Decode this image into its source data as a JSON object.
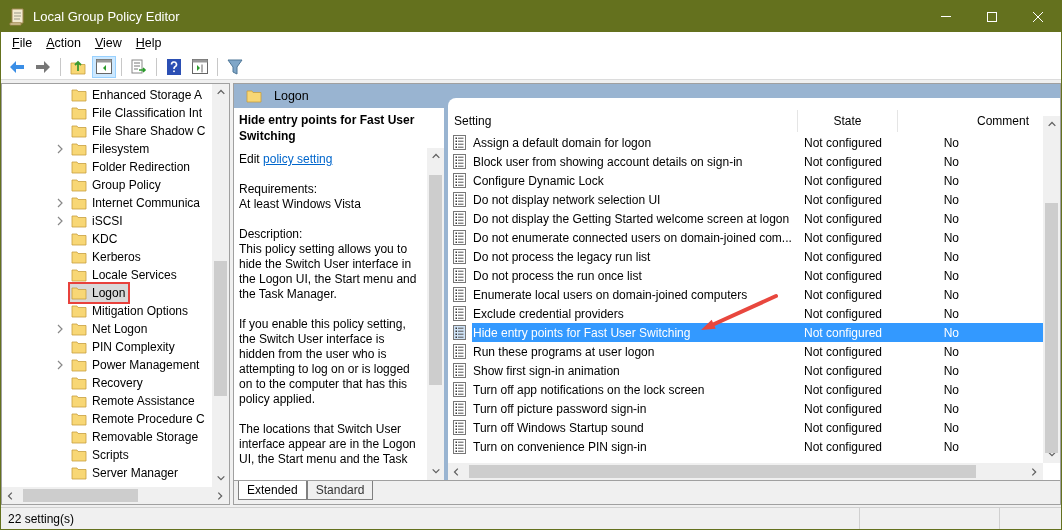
{
  "window": {
    "title": "Local Group Policy Editor"
  },
  "menu": [
    {
      "label": "File"
    },
    {
      "label": "Action"
    },
    {
      "label": "View"
    },
    {
      "label": "Help"
    }
  ],
  "toolbar": [
    {
      "kind": "back",
      "pressed": false
    },
    {
      "kind": "forward",
      "pressed": false
    },
    {
      "kind": "sep"
    },
    {
      "kind": "up",
      "pressed": false
    },
    {
      "kind": "tree",
      "pressed": true
    },
    {
      "kind": "sep"
    },
    {
      "kind": "export",
      "pressed": false
    },
    {
      "kind": "sep"
    },
    {
      "kind": "help",
      "pressed": false
    },
    {
      "kind": "pane",
      "pressed": false
    },
    {
      "kind": "sep"
    },
    {
      "kind": "filter",
      "pressed": false
    }
  ],
  "tree": {
    "items": [
      {
        "label": "Enhanced Storage A",
        "expandable": false,
        "selected": false
      },
      {
        "label": "File Classification Int",
        "expandable": false,
        "selected": false
      },
      {
        "label": "File Share Shadow C",
        "expandable": false,
        "selected": false
      },
      {
        "label": "Filesystem",
        "expandable": true,
        "selected": false
      },
      {
        "label": "Folder Redirection",
        "expandable": false,
        "selected": false
      },
      {
        "label": "Group Policy",
        "expandable": false,
        "selected": false
      },
      {
        "label": "Internet Communica",
        "expandable": true,
        "selected": false
      },
      {
        "label": "iSCSI",
        "expandable": true,
        "selected": false
      },
      {
        "label": "KDC",
        "expandable": false,
        "selected": false
      },
      {
        "label": "Kerberos",
        "expandable": false,
        "selected": false
      },
      {
        "label": "Locale Services",
        "expandable": false,
        "selected": false
      },
      {
        "label": "Logon",
        "expandable": false,
        "selected": true
      },
      {
        "label": "Mitigation Options",
        "expandable": false,
        "selected": false
      },
      {
        "label": "Net Logon",
        "expandable": true,
        "selected": false
      },
      {
        "label": "PIN Complexity",
        "expandable": false,
        "selected": false
      },
      {
        "label": "Power Management",
        "expandable": true,
        "selected": false
      },
      {
        "label": "Recovery",
        "expandable": false,
        "selected": false
      },
      {
        "label": "Remote Assistance",
        "expandable": false,
        "selected": false
      },
      {
        "label": "Remote Procedure C",
        "expandable": false,
        "selected": false
      },
      {
        "label": "Removable Storage",
        "expandable": false,
        "selected": false
      },
      {
        "label": "Scripts",
        "expandable": false,
        "selected": false
      },
      {
        "label": "Server Manager",
        "expandable": false,
        "selected": false
      }
    ]
  },
  "header": {
    "title": "Logon"
  },
  "description": {
    "title": "Hide entry points for Fast User Switching",
    "edit_label": "Edit",
    "edit_link": "policy setting",
    "requirements_label": "Requirements:",
    "requirements": "At least Windows Vista",
    "description_label": "Description:",
    "paragraphs": [
      "This policy setting allows you to hide the Switch User interface in the Logon UI, the Start menu and the Task Manager.",
      "If you enable this policy setting, the Switch User interface is hidden from the user who is attempting to log on or is logged on to the computer that has this policy applied.",
      "The locations that Switch User interface appear are in the Logon UI, the Start menu and the Task"
    ]
  },
  "table": {
    "columns": [
      "Setting",
      "State",
      "Comment"
    ],
    "rows": [
      {
        "setting": "Assign a default domain for logon",
        "state": "Not configured",
        "comment": "No",
        "selected": false
      },
      {
        "setting": "Block user from showing account details on sign-in",
        "state": "Not configured",
        "comment": "No",
        "selected": false
      },
      {
        "setting": "Configure Dynamic Lock",
        "state": "Not configured",
        "comment": "No",
        "selected": false
      },
      {
        "setting": "Do not display network selection UI",
        "state": "Not configured",
        "comment": "No",
        "selected": false
      },
      {
        "setting": "Do not display the Getting Started welcome screen at logon",
        "state": "Not configured",
        "comment": "No",
        "selected": false
      },
      {
        "setting": "Do not enumerate connected users on domain-joined com...",
        "state": "Not configured",
        "comment": "No",
        "selected": false
      },
      {
        "setting": "Do not process the legacy run list",
        "state": "Not configured",
        "comment": "No",
        "selected": false
      },
      {
        "setting": "Do not process the run once list",
        "state": "Not configured",
        "comment": "No",
        "selected": false
      },
      {
        "setting": "Enumerate local users on domain-joined computers",
        "state": "Not configured",
        "comment": "No",
        "selected": false
      },
      {
        "setting": "Exclude credential providers",
        "state": "Not configured",
        "comment": "No",
        "selected": false
      },
      {
        "setting": "Hide entry points for Fast User Switching",
        "state": "Not configured",
        "comment": "No",
        "selected": true
      },
      {
        "setting": "Run these programs at user logon",
        "state": "Not configured",
        "comment": "No",
        "selected": false
      },
      {
        "setting": "Show first sign-in animation",
        "state": "Not configured",
        "comment": "No",
        "selected": false
      },
      {
        "setting": "Turn off app notifications on the lock screen",
        "state": "Not configured",
        "comment": "No",
        "selected": false
      },
      {
        "setting": "Turn off picture password sign-in",
        "state": "Not configured",
        "comment": "No",
        "selected": false
      },
      {
        "setting": "Turn off Windows Startup sound",
        "state": "Not configured",
        "comment": "No",
        "selected": false
      },
      {
        "setting": "Turn on convenience PIN sign-in",
        "state": "Not configured",
        "comment": "No",
        "selected": false
      }
    ]
  },
  "tabs": [
    {
      "label": "Extended",
      "selected": true
    },
    {
      "label": "Standard",
      "selected": false
    }
  ],
  "status_bar": {
    "text": "22 setting(s)"
  }
}
